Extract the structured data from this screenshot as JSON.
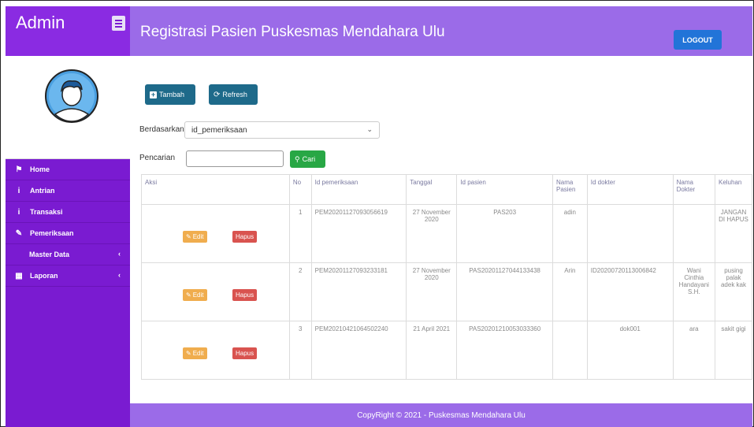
{
  "sidebar": {
    "brand": "Admin",
    "items": [
      {
        "label": "Home",
        "icon": "home-icon"
      },
      {
        "label": "Antrian",
        "icon": "info-icon"
      },
      {
        "label": "Transaksi",
        "icon": "info-icon"
      },
      {
        "label": "Pemeriksaan",
        "icon": "edit-icon"
      },
      {
        "label": "Master Data",
        "icon": "chevron-left-icon"
      },
      {
        "label": "Laporan",
        "icon": "calendar-icon"
      }
    ]
  },
  "header": {
    "title": "Registrasi Pasien Puskesmas Mendahara Ulu",
    "logout_label": "LOGOUT"
  },
  "toolbar": {
    "tambah_label": "Tambah",
    "refresh_label": "Refresh",
    "filter_label": "Berdasarkan:",
    "filter_value": "id_pemeriksaan",
    "search_label": "Pencarian",
    "search_value": "",
    "cari_label": "Cari"
  },
  "table": {
    "headers": [
      "Aksi",
      "No",
      "Id pemeriksaan",
      "Tanggal",
      "Id pasien",
      "Nama Pasien",
      "Id dokter",
      "Nama Dokter",
      "Keluhan"
    ],
    "edit_label": "Edit",
    "hapus_label": "Hapus",
    "rows": [
      {
        "no": "1",
        "id_pemeriksaan": "PEM20201127093056619",
        "tanggal": "27 November 2020",
        "id_pasien": "PAS203",
        "nama_pasien": "adin",
        "id_dokter": "",
        "nama_dokter": "",
        "keluhan": "JANGAN DI HAPUS"
      },
      {
        "no": "2",
        "id_pemeriksaan": "PEM20201127093233181",
        "tanggal": "27 November 2020",
        "id_pasien": "PAS20201127044133438",
        "nama_pasien": "Arin",
        "id_dokter": "ID20200720113006842",
        "nama_dokter": "Wani Cinthia Handayani S.H.",
        "keluhan": "pusing palak adek kak"
      },
      {
        "no": "3",
        "id_pemeriksaan": "PEM20210421064502240",
        "tanggal": "21 April 2021",
        "id_pasien": "PAS20201210053033360",
        "nama_pasien": "",
        "id_dokter": "dok001",
        "nama_dokter": "ara",
        "keluhan": "sakit gigi"
      }
    ]
  },
  "footer": {
    "text": "CopyRight © 2021 - Puskesmas Mendahara Ulu"
  },
  "colors": {
    "sidebar": "#7a1bd1",
    "header": "#9b6be8",
    "logout": "#2274d8",
    "edit": "#f0ad4e",
    "hapus": "#d9534f",
    "cari": "#28a745"
  }
}
